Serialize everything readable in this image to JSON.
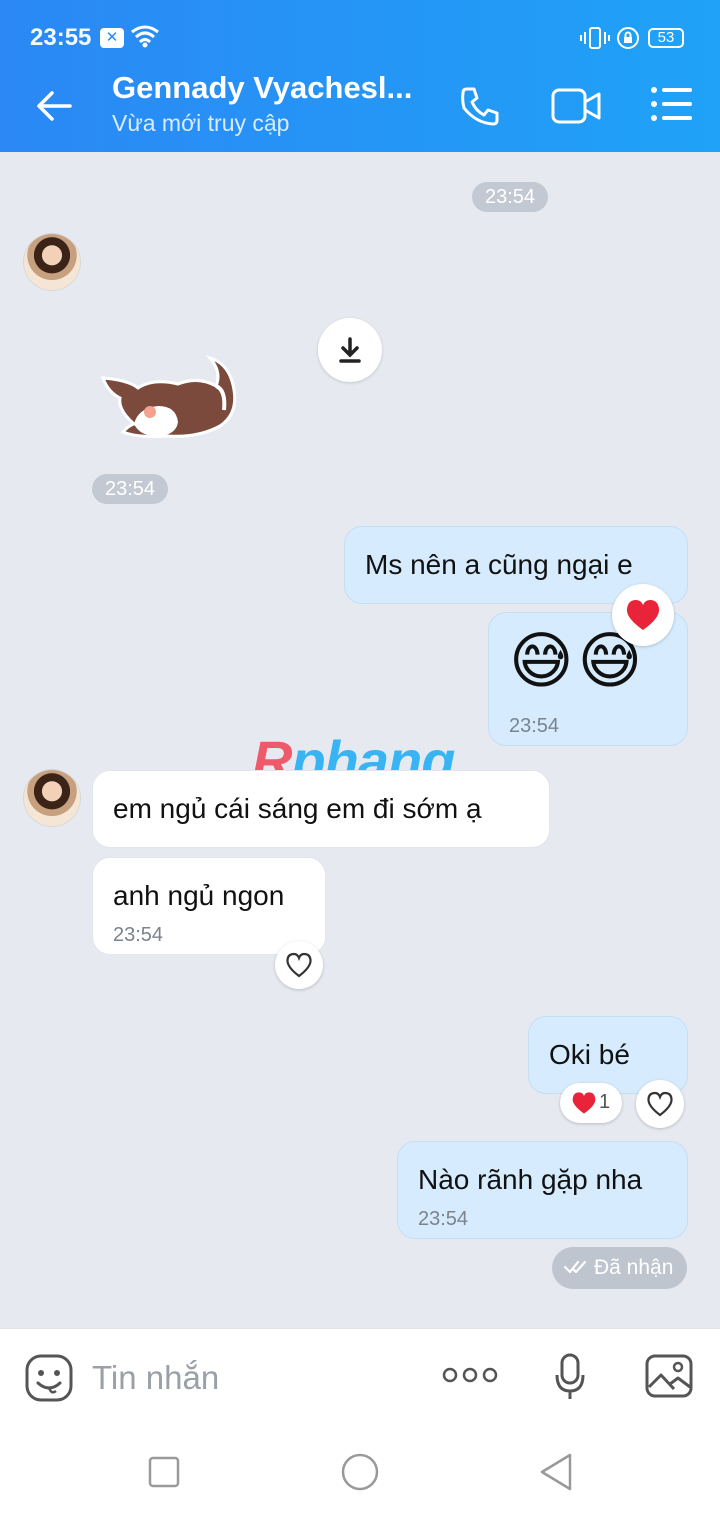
{
  "status_bar": {
    "time": "23:55",
    "battery": "53"
  },
  "header": {
    "contact_name": "Gennady Vyachesl...",
    "status": "Vừa mới truy cập"
  },
  "messages": {
    "time_pill_1": "23:54",
    "sticker_time": "23:54",
    "out_1": "Ms nên a cũng ngại e",
    "out_emoji": "😅😅",
    "out_emoji_time": "23:54",
    "in_1": "em ngủ cái sáng em đi sớm ạ",
    "in_2": "anh ngủ ngon",
    "in_2_time": "23:54",
    "out_2": "Oki bé",
    "out_2_reaction_count": "1",
    "out_3": "Nào rãnh gặp nha",
    "out_3_time": "23:54",
    "delivered": "Đã nhận"
  },
  "watermark": {
    "part1": "R",
    "part2": "phang"
  },
  "composer": {
    "placeholder": "Tin nhắn"
  },
  "colors": {
    "header_blue": "#2b88f5",
    "outgoing_bubble": "#d6ecfe",
    "incoming_bubble": "#ffffff",
    "chat_bg": "#e6eaf0"
  }
}
